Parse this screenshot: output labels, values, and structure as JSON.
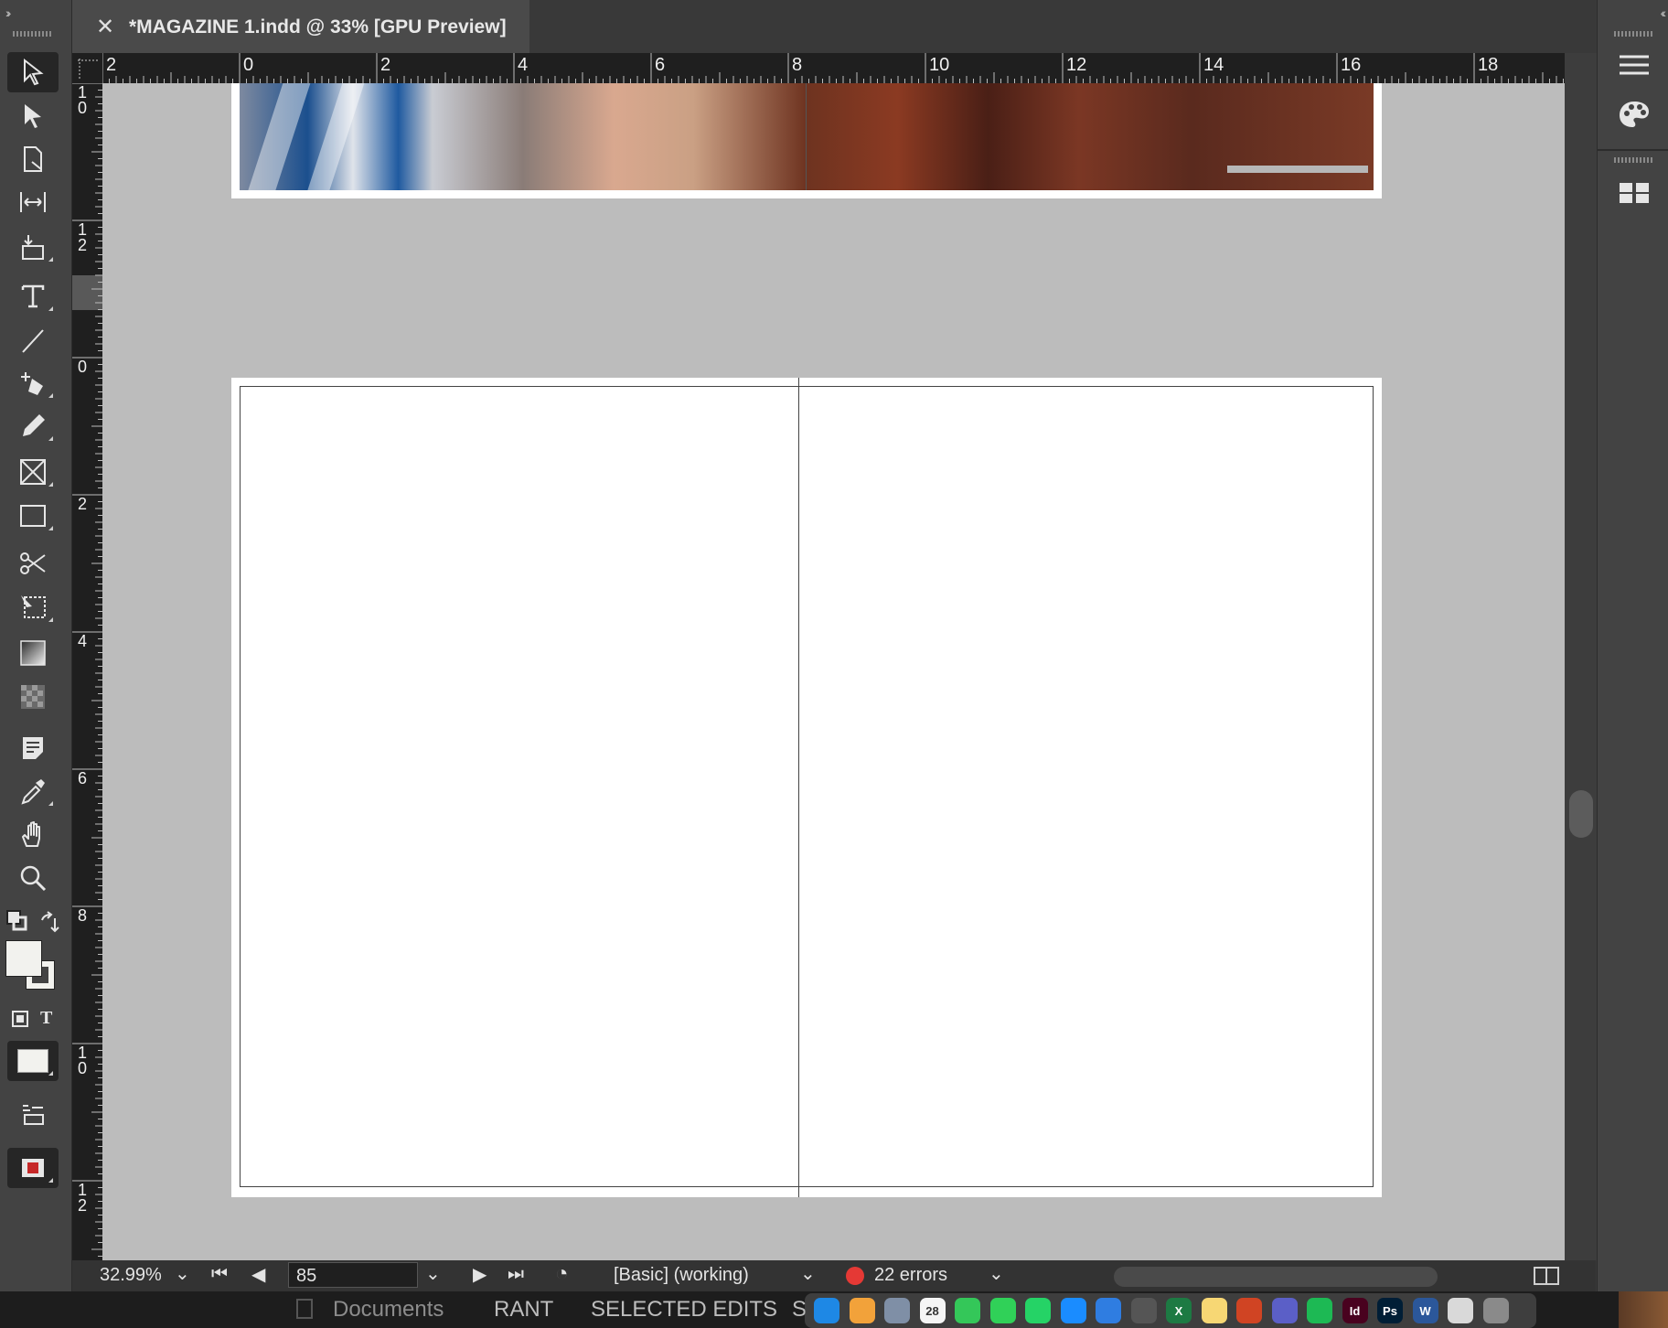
{
  "document_tab": {
    "close_glyph": "✕",
    "title": "*MAGAZINE 1.indd @ 33% [GPU Preview]"
  },
  "panels": {
    "left_collapse": "››",
    "right_collapse": "‹‹"
  },
  "tools": [
    "selection-tool",
    "direct-selection-tool",
    "page-tool",
    "gap-tool",
    "content-collector-tool",
    "type-tool",
    "line-tool",
    "pen-tool",
    "pencil-tool",
    "rectangle-frame-tool",
    "rectangle-tool",
    "scissors-tool",
    "free-transform-tool",
    "gradient-swatch-tool",
    "gradient-feather-tool",
    "note-tool",
    "eyedropper-tool",
    "hand-tool",
    "zoom-tool"
  ],
  "right_panel_icons": [
    "panel-menu-icon",
    "color-theme-icon",
    "pages-icon"
  ],
  "rulers": {
    "horizontal_labels": [
      "2",
      "0",
      "2",
      "4",
      "6",
      "8",
      "10",
      "12",
      "14",
      "16",
      "18"
    ],
    "vertical_labels": [
      "1\n0",
      "1\n2",
      "0",
      "2",
      "4",
      "6",
      "8",
      "1\n0",
      "1\n2"
    ]
  },
  "status_bar": {
    "zoom": "32.99%",
    "page_number": "85",
    "profile": "[Basic] (working)",
    "errors": "22 errors",
    "error_color": "#e53935"
  },
  "bottom_strip": {
    "items": [
      "Documents",
      "RANT",
      "SELECTED EDITS",
      "S"
    ]
  },
  "dock_icons": [
    {
      "name": "finder-icon",
      "color": "#1e88e5",
      "glyph": ""
    },
    {
      "name": "photos-icon",
      "color": "#f2a23a",
      "glyph": ""
    },
    {
      "name": "launchpad-icon",
      "color": "#7f8fa6",
      "glyph": ""
    },
    {
      "name": "calendar-icon",
      "color": "#f5f5f5",
      "glyph": "28"
    },
    {
      "name": "facetime-icon",
      "color": "#34c759",
      "glyph": ""
    },
    {
      "name": "messages-icon",
      "color": "#30d158",
      "glyph": ""
    },
    {
      "name": "whatsapp-icon",
      "color": "#25d366",
      "glyph": ""
    },
    {
      "name": "safari-icon",
      "color": "#1a8cff",
      "glyph": ""
    },
    {
      "name": "keynote-icon",
      "color": "#2f7de1",
      "glyph": ""
    },
    {
      "name": "chatgpt-icon",
      "color": "#555555",
      "glyph": ""
    },
    {
      "name": "excel-icon",
      "color": "#1d7a43",
      "glyph": "X"
    },
    {
      "name": "notes-icon",
      "color": "#f7d774",
      "glyph": ""
    },
    {
      "name": "powerpoint-icon",
      "color": "#d04423",
      "glyph": ""
    },
    {
      "name": "teams-icon",
      "color": "#5b5fc7",
      "glyph": ""
    },
    {
      "name": "spotify-icon",
      "color": "#1db954",
      "glyph": ""
    },
    {
      "name": "indesign-icon",
      "color": "#49021f",
      "glyph": "Id"
    },
    {
      "name": "photoshop-icon",
      "color": "#001e36",
      "glyph": "Ps"
    },
    {
      "name": "word-icon",
      "color": "#2b579a",
      "glyph": "W"
    },
    {
      "name": "preview-icon",
      "color": "#d9d9d9",
      "glyph": ""
    },
    {
      "name": "trash-icon",
      "color": "#8a8a8a",
      "glyph": ""
    }
  ]
}
